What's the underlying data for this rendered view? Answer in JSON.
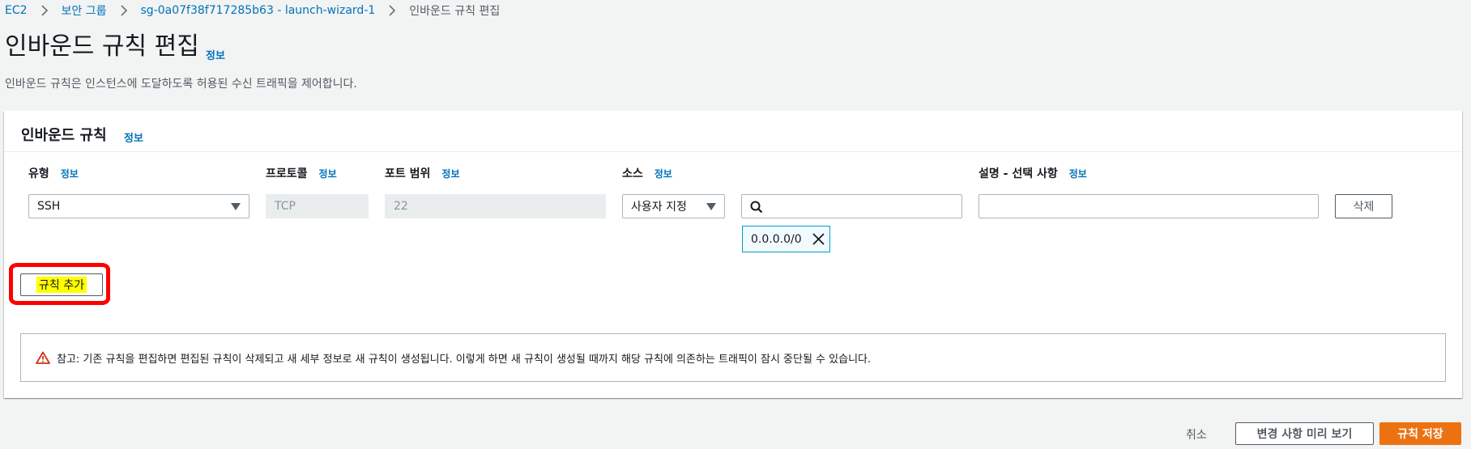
{
  "breadcrumb": [
    {
      "label": "EC2"
    },
    {
      "label": "보안 그룹"
    },
    {
      "label": "sg-0a07f38f717285b63 - launch-wizard-1"
    },
    {
      "label": "인바운드 규칙 편집"
    }
  ],
  "page": {
    "title": "인바운드 규칙 편집",
    "info_link": "정보",
    "description": "인바운드 규칙은 인스턴스에 도달하도록 허용된 수신 트래픽을 제어합니다."
  },
  "panel": {
    "title": "인바운드 규칙",
    "info_link": "정보",
    "columns": {
      "type": {
        "label": "유형",
        "info": "정보"
      },
      "protocol": {
        "label": "프로토콜",
        "info": "정보"
      },
      "port_range": {
        "label": "포트 범위",
        "info": "정보"
      },
      "source": {
        "label": "소스",
        "info": "정보"
      },
      "description": {
        "label": "설명 - 선택 사항",
        "info": "정보"
      }
    },
    "rule": {
      "type_value": "SSH",
      "protocol_value": "TCP",
      "port_value": "22",
      "source_type_value": "사용자 지정",
      "source_search_value": "",
      "source_token": "0.0.0.0/0",
      "description_value": "",
      "delete_label": "삭제"
    },
    "add_rule_label": "규칙 추가",
    "alert_text": "참고: 기존 규칙을 편집하면 편집된 규칙이 삭제되고 새 세부 정보로 새 규칙이 생성됩니다. 이렇게 하면 새 규칙이 생성될 때까지 해당 규칙에 의존하는 트래픽이 잠시 중단될 수 있습니다."
  },
  "footer": {
    "cancel_label": "취소",
    "preview_label": "변경 사항 미리 보기",
    "save_label": "규칙 저장"
  },
  "colors": {
    "link": "#0073bb",
    "primary_button": "#ec7211",
    "annotation_ring": "#ff0000",
    "highlight": "#ffff00",
    "warning_icon": "#d13212"
  },
  "icons": [
    "chevron-right-icon",
    "caret-down-icon",
    "search-icon",
    "close-icon",
    "warning-icon"
  ]
}
